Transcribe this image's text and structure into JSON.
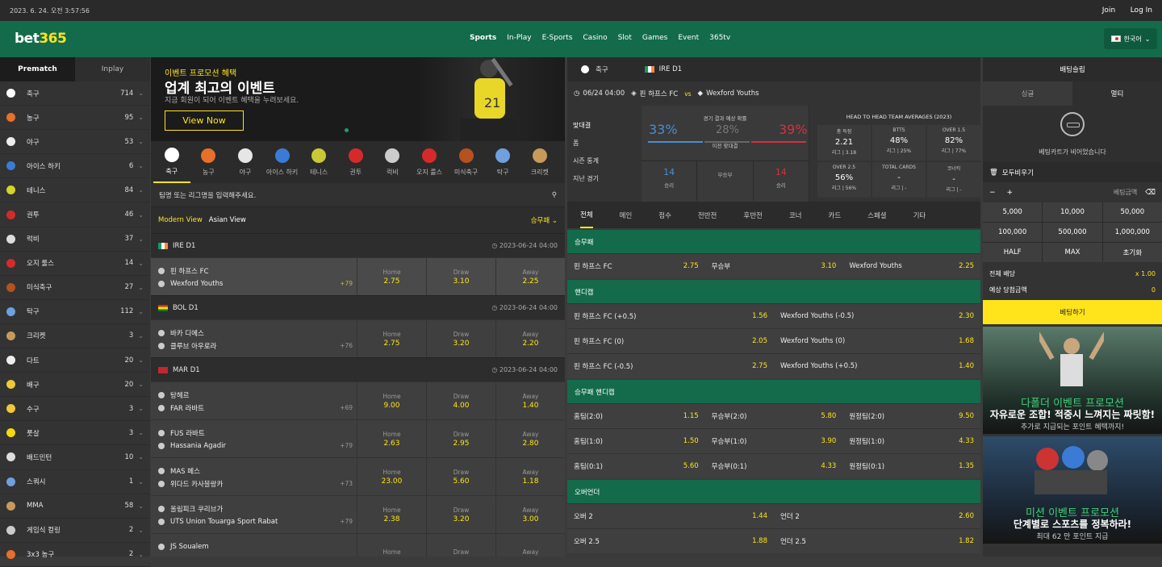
{
  "topbar": {
    "datetime": "2023. 6. 24. 오전 3:57:56",
    "join": "Join",
    "login": "Log In"
  },
  "logo": {
    "main": "bet",
    "accent": "365"
  },
  "nav": [
    "Sports",
    "In-Play",
    "E-Sports",
    "Casino",
    "Slot",
    "Games",
    "Event",
    "365tv"
  ],
  "lang": "한국어",
  "sidebar": {
    "tabs": [
      "Prematch",
      "Inplay"
    ],
    "items": [
      {
        "name": "축구",
        "count": "714",
        "color": "#ffffff"
      },
      {
        "name": "농구",
        "count": "95",
        "color": "#e8702a"
      },
      {
        "name": "야구",
        "count": "53",
        "color": "#eeeeee"
      },
      {
        "name": "아이스 하키",
        "count": "6",
        "color": "#3b7bd6"
      },
      {
        "name": "테니스",
        "count": "84",
        "color": "#d4d42a"
      },
      {
        "name": "권투",
        "count": "46",
        "color": "#d62a2a"
      },
      {
        "name": "럭비",
        "count": "37",
        "color": "#dddddd"
      },
      {
        "name": "오지 룰스",
        "count": "14",
        "color": "#d62a2a"
      },
      {
        "name": "미식축구",
        "count": "27",
        "color": "#b5521f"
      },
      {
        "name": "탁구",
        "count": "112",
        "color": "#6fa0e0"
      },
      {
        "name": "크리켓",
        "count": "3",
        "color": "#c79a5b"
      },
      {
        "name": "다트",
        "count": "20",
        "color": "#eeeeee"
      },
      {
        "name": "배구",
        "count": "20",
        "color": "#f0c838"
      },
      {
        "name": "수구",
        "count": "3",
        "color": "#f0c838"
      },
      {
        "name": "풋살",
        "count": "3",
        "color": "#f5d90a"
      },
      {
        "name": "배드민턴",
        "count": "10",
        "color": "#dddddd"
      },
      {
        "name": "스쿼시",
        "count": "1",
        "color": "#6fa0e0"
      },
      {
        "name": "MMA",
        "count": "58",
        "color": "#c79a5b"
      },
      {
        "name": "게임식 컬링",
        "count": "2",
        "color": "#cccccc"
      },
      {
        "name": "3x3 농구",
        "count": "2",
        "color": "#e8702a"
      }
    ]
  },
  "banner": {
    "line1": "이벤트 프로모션 혜택",
    "line2": "업계 최고의 이벤트",
    "line3": "지금 회원이 되어 이벤트 혜택을 누려보세요.",
    "cta": "View Now"
  },
  "sports_bar": [
    {
      "label": "축구",
      "color": "#ffffff"
    },
    {
      "label": "농구",
      "color": "#e8702a"
    },
    {
      "label": "야구",
      "color": "#e6e6e6"
    },
    {
      "label": "아이스 하키",
      "color": "#3b7bd6"
    },
    {
      "label": "테니스",
      "color": "#c9c935"
    },
    {
      "label": "권투",
      "color": "#d62a2a"
    },
    {
      "label": "럭비",
      "color": "#cccccc"
    },
    {
      "label": "오지 룰스",
      "color": "#d62a2a"
    },
    {
      "label": "미식축구",
      "color": "#b5521f"
    },
    {
      "label": "탁구",
      "color": "#6fa0e0"
    },
    {
      "label": "크리켓",
      "color": "#c79a5b"
    }
  ],
  "search": {
    "placeholder": "팀명 또는 리그명을 입력해주세요."
  },
  "viewbar": {
    "modern": "Modern View",
    "asian": "Asian View",
    "sort": "승무패"
  },
  "leagues": [
    {
      "name": "IRE D1",
      "date": "2023-06-24 04:00",
      "flag": "linear-gradient(90deg,#169b62 33%,#fff 33% 66%,#ff883e 66%)",
      "matches": [
        {
          "home": "핀 하프스 FC",
          "away": "Wexford Youths",
          "more": "+79",
          "hl": true,
          "odds": [
            "2.75",
            "3.10",
            "2.25"
          ]
        }
      ]
    },
    {
      "name": "BOL D1",
      "date": "2023-06-24 04:00",
      "flag": "linear-gradient(180deg,#d52b1e 33%,#f9e300 33% 66%,#007934 66%)",
      "matches": [
        {
          "home": "바카 디에스",
          "away": "클루브 아우로라",
          "more": "+76",
          "hl": false,
          "odds": [
            "2.75",
            "3.20",
            "2.20"
          ]
        }
      ]
    },
    {
      "name": "MAR D1",
      "date": "2023-06-24 04:00",
      "flag": "#c1272d",
      "matches": [
        {
          "home": "탕헤르",
          "away": "FAR 라바트",
          "more": "+69",
          "hl": false,
          "odds": [
            "9.00",
            "4.00",
            "1.40"
          ]
        },
        {
          "home": "FUS 라바트",
          "away": "Hassania Agadir",
          "more": "+79",
          "hl": false,
          "odds": [
            "2.63",
            "2.95",
            "2.80"
          ]
        },
        {
          "home": "MAS 페스",
          "away": "위다드 카사블랑카",
          "more": "+73",
          "hl": false,
          "odds": [
            "23.00",
            "5.60",
            "1.18"
          ]
        },
        {
          "home": "올림피크 쿠리브가",
          "away": "UTS Union Touarga Sport Rabat",
          "more": "+79",
          "hl": false,
          "odds": [
            "2.38",
            "3.20",
            "3.00"
          ]
        },
        {
          "home": "JS Soualem",
          "away": "",
          "more": "",
          "hl": false,
          "odds": [
            "",
            "",
            ""
          ]
        }
      ]
    }
  ],
  "odd_labels": [
    "Home",
    "Draw",
    "Away"
  ],
  "detail": {
    "sport": "축구",
    "league": "IRE D1",
    "time": "06/24 04:00",
    "home": "핀 하프스 FC",
    "vs": "vs",
    "away": "Wexford Youths",
    "menu": [
      "맞대결",
      "폼",
      "시즌 통계",
      "지난 경기"
    ],
    "prob_title": "경기 결과 예상 확률",
    "probs": {
      "home": "33%",
      "draw": "28%",
      "away": "39%"
    },
    "h2h_label": "이전 맞대결",
    "h2h_counts": [
      {
        "v": "14",
        "l": "승리"
      },
      {
        "v": "",
        "l": "무승부"
      },
      {
        "v": "14",
        "l": "승리"
      }
    ],
    "h2h_title": "HEAD TO HEAD TEAM AVERAGES (2023)",
    "h2h_cells": [
      {
        "t": "총 득점",
        "v": "2.21",
        "s": "리그 | 3.18"
      },
      {
        "t": "BTTS",
        "v": "48%",
        "s": "리그 | 25%"
      },
      {
        "t": "OVER 1.5",
        "v": "82%",
        "s": "리그 | 77%"
      },
      {
        "t": "OVER 2.5",
        "v": "56%",
        "s": "리그 | 56%"
      },
      {
        "t": "TOTAL CARDS",
        "v": "-",
        "s": "리그 | -"
      },
      {
        "t": "코너킥",
        "v": "-",
        "s": "리그 | -"
      }
    ],
    "tabs": [
      "전체",
      "메인",
      "점수",
      "전반전",
      "후반전",
      "코너",
      "카드",
      "스페셜",
      "기타"
    ],
    "sections": [
      {
        "title": "승무패",
        "rows": [
          [
            [
              "핀 하프스 FC",
              "2.75"
            ],
            [
              "무승부",
              "3.10"
            ],
            [
              "Wexford Youths",
              "2.25"
            ]
          ]
        ]
      },
      {
        "title": "핸디캡",
        "rows": [
          [
            [
              "핀 하프스 FC (+0.5)",
              "1.56"
            ],
            [
              "Wexford Youths (-0.5)",
              "2.30"
            ]
          ],
          [
            [
              "핀 하프스 FC (0)",
              "2.05"
            ],
            [
              "Wexford Youths (0)",
              "1.68"
            ]
          ],
          [
            [
              "핀 하프스 FC (-0.5)",
              "2.75"
            ],
            [
              "Wexford Youths (+0.5)",
              "1.40"
            ]
          ]
        ]
      },
      {
        "title": "승무패 핸디캡",
        "rows": [
          [
            [
              "홈팀(2:0)",
              "1.15"
            ],
            [
              "무승부(2:0)",
              "5.80"
            ],
            [
              "원정팀(2:0)",
              "9.50"
            ]
          ],
          [
            [
              "홈팀(1:0)",
              "1.50"
            ],
            [
              "무승부(1:0)",
              "3.90"
            ],
            [
              "원정팀(1:0)",
              "4.33"
            ]
          ],
          [
            [
              "홈팀(0:1)",
              "5.60"
            ],
            [
              "무승부(0:1)",
              "4.33"
            ],
            [
              "원정팀(0:1)",
              "1.35"
            ]
          ]
        ]
      },
      {
        "title": "오버언더",
        "rows": [
          [
            [
              "오버 2",
              "1.44"
            ],
            [
              "언더 2",
              "2.60"
            ]
          ],
          [
            [
              "오버 2.5",
              "1.88"
            ],
            [
              "언더 2.5",
              "1.82"
            ]
          ]
        ]
      }
    ]
  },
  "slip": {
    "header": "배팅슬립",
    "tabs": [
      "싱글",
      "멀티"
    ],
    "empty": "베팅카트가 비어었습니다",
    "clear": "모두비우기",
    "amount_label": "베팅금액",
    "keys": [
      "5,000",
      "10,000",
      "50,000",
      "100,000",
      "500,000",
      "1,000,000",
      "HALF",
      "MAX",
      "초기화"
    ],
    "total_label": "전체 배당",
    "total_value": "x 1.00",
    "win_label": "예상 당첨금액",
    "win_value": "0",
    "bet_button": "베팅하기",
    "promo1": {
      "t1": "다폴더 이벤트 프로모션",
      "t2": "자유로운 조합! 적중시 느껴지는 짜릿함!",
      "t3": "추가로 지급되는 포인트 혜택까지!"
    },
    "promo2": {
      "t1": "미션 이벤트 프로모션",
      "t2": "단계별로 스포츠를 정복하라!",
      "t3": "최대 62 만 포인트 지급"
    }
  }
}
